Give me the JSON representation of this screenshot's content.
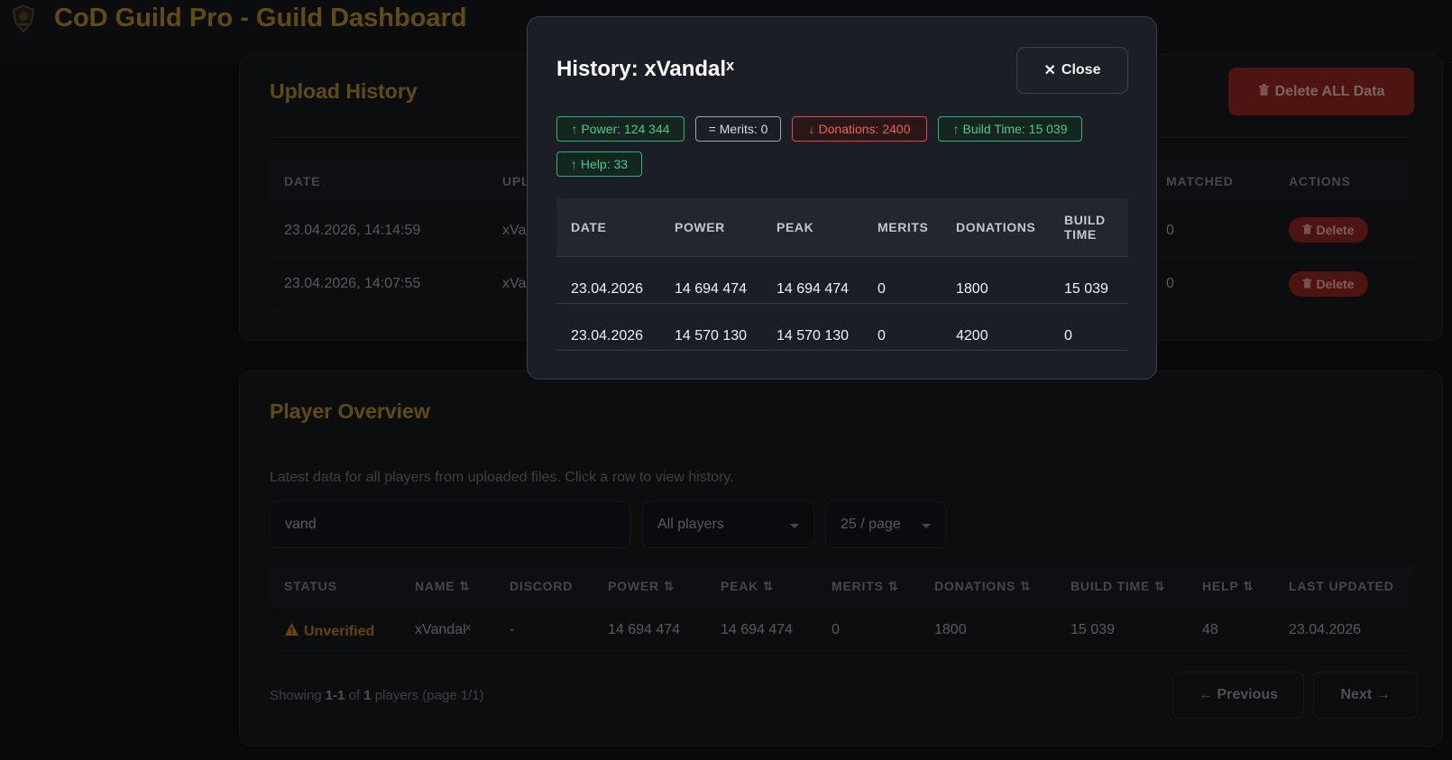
{
  "app": {
    "title": "CoD Guild Pro - Guild Dashboard"
  },
  "upload_history": {
    "title": "Upload History",
    "delete_all_label": "Delete ALL Data",
    "columns": [
      "DATE",
      "UPL",
      "MATCHED",
      "ACTIONS"
    ],
    "rows": [
      {
        "date": "23.04.2026, 14:14:59",
        "uploaded": "xVa",
        "matched": "0",
        "action": "Delete"
      },
      {
        "date": "23.04.2026, 14:07:55",
        "uploaded": "xVa",
        "matched": "0",
        "action": "Delete"
      }
    ]
  },
  "player_overview": {
    "title": "Player Overview",
    "subtitle": "Latest data for all players from uploaded files. Click a row to view history.",
    "search_value": "vand",
    "filter_value": "All players",
    "page_size_value": "25 / page",
    "columns": [
      "STATUS",
      "NAME ⇅",
      "DISCORD",
      "POWER ⇅",
      "PEAK ⇅",
      "MERITS ⇅",
      "DONATIONS ⇅",
      "BUILD TIME ⇅",
      "HELP ⇅",
      "LAST UPDATED"
    ],
    "rows": [
      {
        "status": "Unverified",
        "name": "xVandalˣ",
        "discord": "-",
        "power": "14 694 474",
        "peak": "14 694 474",
        "merits": "0",
        "donations": "1800",
        "build_time": "15 039",
        "help": "48",
        "last_updated": "23.04.2026"
      }
    ],
    "showing": {
      "prefix": "Showing",
      "range": "1-1",
      "of": "of",
      "total": "1",
      "suffix": "players (page 1/1)"
    },
    "prev_label": "← Previous",
    "next_label": "Next →"
  },
  "modal": {
    "title": "History: xVandalˣ",
    "close_label": "Close",
    "badges": [
      {
        "dir": "up",
        "arrow": "↑",
        "text": "Power: 124 344"
      },
      {
        "dir": "eq",
        "arrow": "=",
        "text": "Merits: 0"
      },
      {
        "dir": "down",
        "arrow": "↓",
        "text": "Donations: 2400"
      },
      {
        "dir": "up",
        "arrow": "↑",
        "text": "Build Time: 15 039"
      },
      {
        "dir": "up",
        "arrow": "↑",
        "text": "Help: 33"
      }
    ],
    "columns": [
      "DATE",
      "POWER",
      "PEAK",
      "MERITS",
      "DONATIONS",
      "BUILD TIME"
    ],
    "rows": [
      {
        "date": "23.04.2026",
        "power": "14 694 474",
        "peak": "14 694 474",
        "merits": "0",
        "donations": "1800",
        "build_time": "15 039"
      },
      {
        "date": "23.04.2026",
        "power": "14 570 130",
        "peak": "14 570 130",
        "merits": "0",
        "donations": "4200",
        "build_time": "0"
      }
    ]
  },
  "colors": {
    "accent_gold": "#b08a1f",
    "danger": "#8c2620",
    "badge_up": "#4cc88f",
    "badge_down": "#ee5c5c"
  }
}
